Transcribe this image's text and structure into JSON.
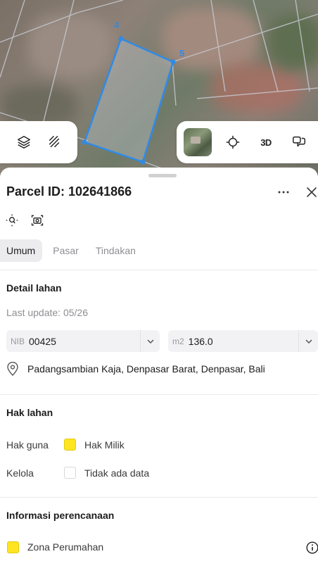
{
  "map": {
    "vertex_labels": [
      "4",
      "5"
    ],
    "parcel_color": "#2f8be6",
    "tools_left": [
      {
        "name": "layers-icon"
      },
      {
        "name": "draw-route-icon"
      }
    ],
    "tools_right": {
      "three_d_label": "3D"
    }
  },
  "sheet": {
    "title": "Parcel ID: 102641866",
    "tabs": [
      {
        "label": "Umum",
        "active": true
      },
      {
        "label": "Pasar",
        "active": false
      },
      {
        "label": "Tindakan",
        "active": false
      }
    ],
    "detail": {
      "title": "Detail lahan",
      "last_update": "Last update: 05/26",
      "nib_prefix": "NIB",
      "nib_value": "00425",
      "area_prefix": "m2",
      "area_value": "136.0",
      "address": "Padangsambian Kaja, Denpasar Barat, Denpasar, Bali"
    },
    "rights": {
      "title": "Hak lahan",
      "rows": [
        {
          "label": "Hak guna",
          "value": "Hak Milik",
          "color": "#ffe51f"
        },
        {
          "label": "Kelola",
          "value": "Tidak ada data",
          "color": "#ffffff"
        }
      ]
    },
    "planning": {
      "title": "Informasi perencanaan",
      "zone_label": "Zona Perumahan",
      "zone_color": "#ffe51f"
    }
  }
}
